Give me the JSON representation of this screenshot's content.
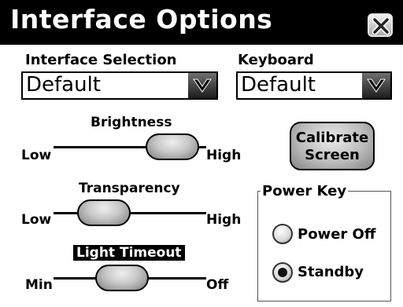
{
  "window": {
    "title": "Interface Options",
    "close_icon": "close-icon"
  },
  "interface_selection": {
    "label": "Interface Selection",
    "value": "Default"
  },
  "keyboard": {
    "label": "Keyboard",
    "value": "Default"
  },
  "sliders": {
    "brightness": {
      "label": "Brightness",
      "min_label": "Low",
      "max_label": "High",
      "level": 0.78
    },
    "transparency": {
      "label": "Transparency",
      "min_label": "Low",
      "max_label": "High",
      "level": 0.33
    },
    "light_timeout": {
      "label": "Light Timeout",
      "min_label": "Min",
      "max_label": "Off",
      "level": 0.45
    }
  },
  "calibrate": {
    "line1": "Calibrate",
    "line2": "Screen"
  },
  "power_key": {
    "title": "Power Key",
    "options": [
      {
        "label": "Power Off",
        "selected": false
      },
      {
        "label": "Standby",
        "selected": true
      }
    ]
  }
}
